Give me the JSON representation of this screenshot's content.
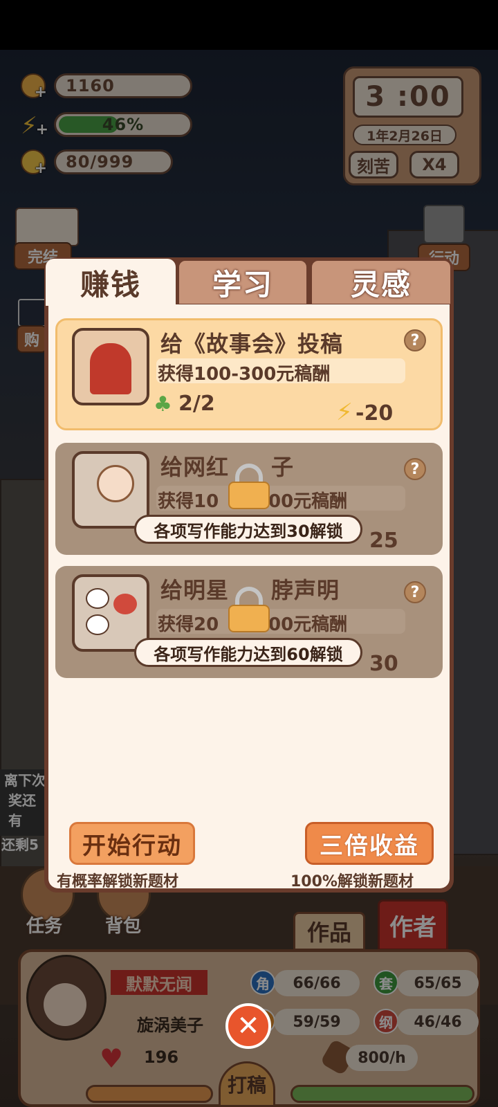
{
  "resources": {
    "coins": "1160",
    "energy": "46%",
    "energy_level": 0.46,
    "inspiration": "80/999"
  },
  "clock": {
    "time": "3 :00",
    "date": "1年2月26日",
    "mode": "刻苦",
    "speed": "X4"
  },
  "background_labels": {
    "left_top": "完结",
    "left_mid": "购",
    "right_top": "行动",
    "left_promo_1": "离下次",
    "left_promo_2": "奖还有",
    "left_promo_3": "还剩5",
    "task_label": "任务",
    "bag_label": "背包",
    "works_tab": "作品",
    "author_tab": "作者"
  },
  "tabs": [
    "赚钱",
    "学习",
    "灵感"
  ],
  "tasks": [
    {
      "title": "给《故事会》投稿",
      "reward": "获得100-300元稿酬",
      "count": "2/2",
      "cost": "-20",
      "locked": false
    },
    {
      "title": "给网红写段子",
      "title_visible_left": "给网红",
      "title_visible_right": "子",
      "reward_left": "获得10",
      "reward_right": "00元稿酬",
      "cost": "25",
      "unlock_tip": "各项写作能力达到30解锁",
      "locked": true
    },
    {
      "title": "给明星写脖声明",
      "title_visible_left": "给明星",
      "title_visible_right": "脖声明",
      "reward_left": "获得20",
      "reward_right": "00元稿酬",
      "cost": "30",
      "unlock_tip": "各项写作能力达到60解锁",
      "locked": true
    }
  ],
  "actions": {
    "start_label": "开始行动",
    "start_hint": "有概率解锁新题材",
    "triple_label": "三倍收益",
    "triple_hint": "100%解锁新题材"
  },
  "profile": {
    "pen_name": "默默无闻",
    "name": "旋涡美子",
    "hearts": "196",
    "income": "800/h",
    "write_label": "打稿",
    "stats": [
      {
        "icon": "角",
        "value": "66/66",
        "color": "#2a6fc0"
      },
      {
        "icon": "套",
        "value": "65/65",
        "color": "#3c9a3c"
      },
      {
        "icon": "",
        "value": "59/59",
        "color": "#e08a2a"
      },
      {
        "icon": "纲",
        "value": "46/46",
        "color": "#d04a3c"
      }
    ]
  },
  "colors": {
    "modal_frame": "#6a3c2c",
    "modal_body": "#fdf3e9",
    "active_card": "#fcd9a4",
    "locked_card": "#a8917c",
    "close_button": "#e8552c"
  }
}
